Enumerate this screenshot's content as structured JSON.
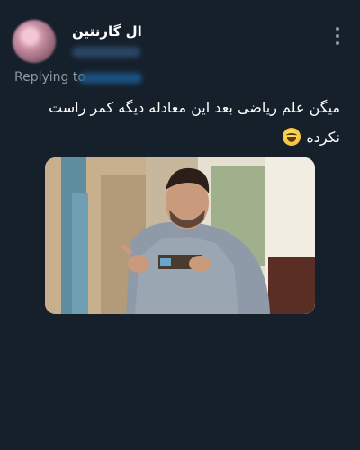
{
  "tweet": {
    "author_name": "ال گارنتین",
    "replying_to_label": "Replying to",
    "text_line1": "میگن علم ریاضی بعد این معادله دیگه کمر راست",
    "text_line2": "نکرده",
    "emoji": "grinning-sweat-face-emoji",
    "media_description": "photo"
  },
  "colors": {
    "background": "#15202b",
    "secondary_text": "#8b98a5",
    "primary_text": "#ffffff"
  }
}
